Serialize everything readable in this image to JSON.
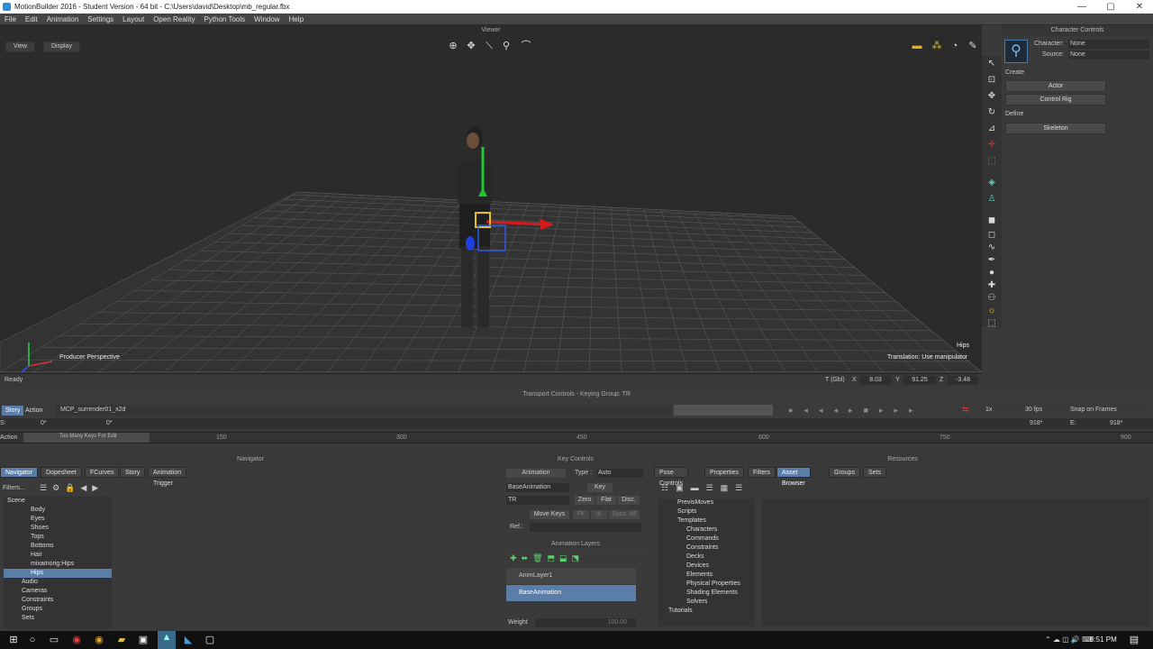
{
  "window": {
    "title": "MotionBuilder 2016 - Student Version  - 64 bit - C:\\Users\\david\\Desktop\\mb_regular.fbx",
    "controls": [
      "—",
      "▢",
      "✕"
    ]
  },
  "menu": [
    "File",
    "Edit",
    "Animation",
    "Settings",
    "Layout",
    "Open Reality",
    "Python Tools",
    "Window",
    "Help"
  ],
  "viewer": {
    "title": "Viewer",
    "view_btn": "View",
    "display_btn": "Display",
    "camera_label": "Producer Perspective",
    "selected_label": "Hips",
    "manip_label": "Translation: Use manipulator"
  },
  "status": {
    "text": "Ready",
    "t_label": "T (Gbl)",
    "x_label": "X",
    "x": "8.03",
    "y_label": "Y",
    "y": "91.25",
    "z_label": "Z",
    "z": "-3.48"
  },
  "character_controls": {
    "title": "Character Controls",
    "character_label": "Character:",
    "character": "None",
    "source_label": "Source:",
    "source": "None",
    "create": "Create",
    "actor": "Actor",
    "control_rig": "Control Rig",
    "define": "Define",
    "skeleton": "Skeleton"
  },
  "transport": {
    "title": "Transport Controls - Keying Group: TR",
    "story_tab": "Story",
    "action_tab": "Action",
    "take": "MCP_surrender01_x2d",
    "speed": "1x",
    "fps": "30 fps",
    "snap": "Snap on Frames",
    "s_label": "S:",
    "s_val": "0*",
    "cur": "0*",
    "e_label": "E:",
    "e_val": "918*",
    "end_val": "918*",
    "action_label": "Action",
    "clip_label": "Too Many Keys For Edit",
    "ruler": [
      "150",
      "300",
      "450",
      "600",
      "750",
      "900"
    ]
  },
  "navigator": {
    "title": "Navigator",
    "tabs": [
      "Navigator",
      "Dopesheet",
      "FCurves",
      "Story",
      "Animation Trigger"
    ],
    "filters": "Filters...",
    "tree": [
      "Scene",
      "Body",
      "Eyes",
      "Shoes",
      "Tops",
      "Bottoms",
      "Hair",
      "mixamorig:Hips",
      "Hips",
      "Audio",
      "Cameras",
      "Constraints",
      "Groups",
      "Sets"
    ]
  },
  "key_controls": {
    "title": "Key Controls",
    "animation": "Animation",
    "type_label": "Type :",
    "type": "Auto",
    "layer": "BaseAnimation",
    "key": "Key",
    "tr": "TR",
    "zero": "Zero",
    "flat": "Flat",
    "disc": "Disc.",
    "move_keys": "Move Keys",
    "fk": "FK",
    "ik": "IK",
    "sync": "Sync. All",
    "ref": "Ref.:",
    "anim_layers": "Animation Layers",
    "layer1": "AnimLayer1",
    "base": "BaseAnimation",
    "weight": "Weight",
    "weight_val": "100.00"
  },
  "resources": {
    "title": "Resources",
    "tabs": [
      "Pose Controls",
      "Properties",
      "Filters",
      "Asset Browser",
      "Groups",
      "Sets"
    ],
    "tree": [
      "PrevisMoves",
      "Scripts",
      "Templates",
      "Characters",
      "Commands",
      "Constraints",
      "Decks",
      "Devices",
      "Elements",
      "Physical Properties",
      "Shading Elements",
      "Solvers",
      "Tutorials"
    ]
  },
  "taskbar": {
    "time": "8:51 PM"
  }
}
